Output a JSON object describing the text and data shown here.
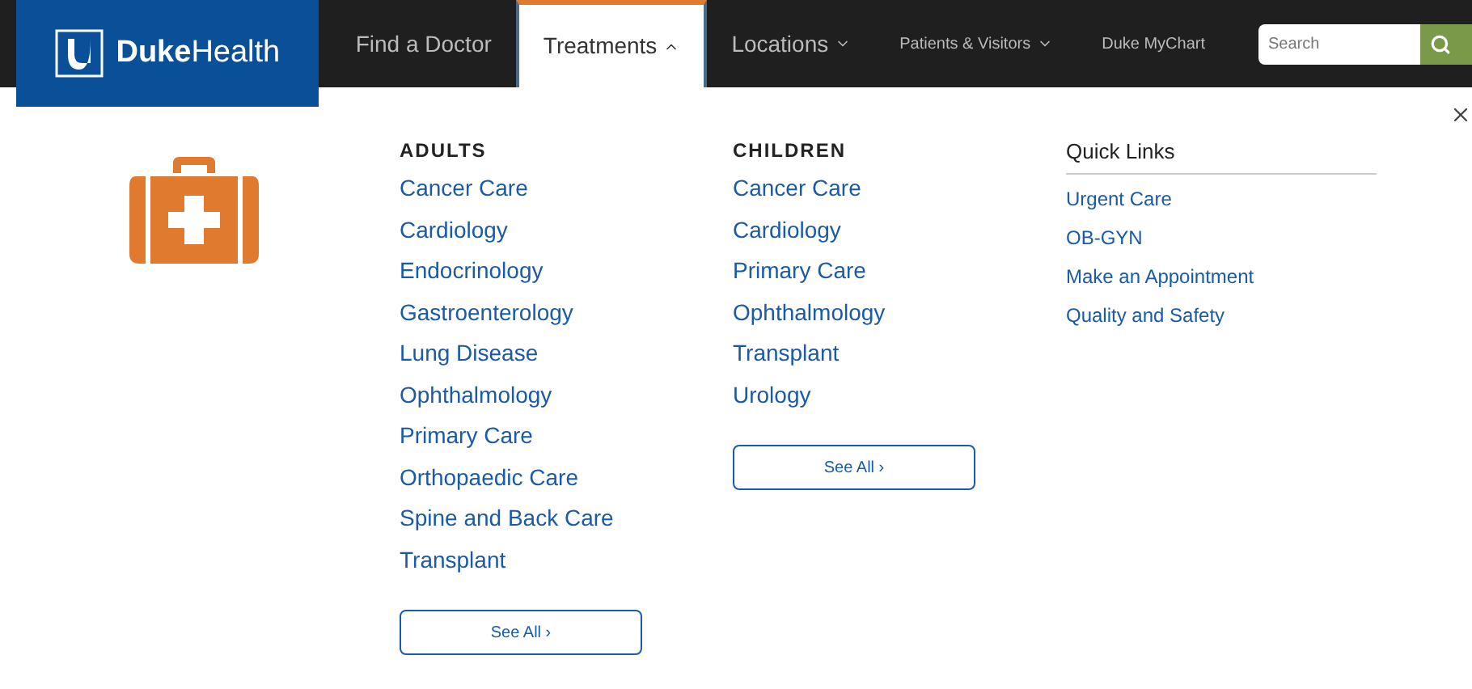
{
  "logo": {
    "text": "**Duke**Health"
  },
  "nav": [
    {
      "label": "Find a Doctor",
      "kind": "primary",
      "dropdown": false,
      "selected": false
    },
    {
      "label": "Treatments",
      "kind": "primary",
      "dropdown": true,
      "selected": true
    },
    {
      "label": "Locations",
      "kind": "primary",
      "dropdown": true,
      "selected": false
    },
    {
      "label": "Patients & Visitors",
      "kind": "utility",
      "dropdown": true,
      "selected": false
    },
    {
      "label": "Duke MyChart",
      "kind": "utility",
      "dropdown": false,
      "selected": false
    }
  ],
  "search": {
    "placeholder": "Search"
  },
  "menu": {
    "columns": [
      {
        "heading": "ADULTS",
        "links": [
          "Cancer Care",
          "Cardiology",
          "Endocrinology",
          "Gastroenterology",
          "Lung Disease",
          "Ophthalmology",
          "Primary Care",
          "Orthopaedic Care",
          "Spine and Back Care",
          "Transplant"
        ],
        "button": "See All ›"
      },
      {
        "heading": "CHILDREN",
        "links": [
          "Cancer Care",
          "Cardiology",
          "Primary Care",
          "Ophthalmology",
          "Transplant",
          "Urology"
        ],
        "button": "See All ›"
      }
    ],
    "quick_links": {
      "heading": "Quick Links",
      "links": [
        "Urgent Care",
        "OB-GYN",
        "Make an Appointment",
        "Quality and Safety"
      ]
    }
  }
}
